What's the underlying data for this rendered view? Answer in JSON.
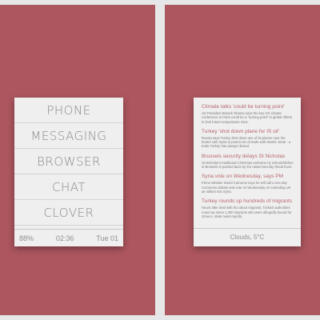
{
  "launcher": {
    "apps": [
      "PHONE",
      "MESSAGING",
      "BROWSER",
      "CHAT",
      "CLOVER"
    ],
    "status": {
      "battery": "88%",
      "time": "02:36",
      "date": "Tue 01"
    }
  },
  "news": {
    "items": [
      {
        "headline": "Climate talks 'could be turning point'",
        "body": "US President Barack Obama says the key UN climate conference in Paris could be a \"turning point\" in global efforts to limit future temperature rises."
      },
      {
        "headline": "Turkey 'shot down plane for IS oil'",
        "body": "Russia says Turkey shot down one of its planes near the border with Syria to protect its oil trade with Islamic State - a trade Turkey has always denied."
      },
      {
        "headline": "Brussels security delays St Nicholas",
        "body": "St Nicholas's traditional Christmas welcome by schoolchildren in Brussels is pushed back by the raised security threat level."
      },
      {
        "headline": "Syria vote on Wednesday, says PM",
        "body": "Prime Minister David Cameron says he will call a one-day Commons debate and vote on Wednesday on extending UK air strikes into Syria."
      },
      {
        "headline": "Turkey rounds up hundreds of migrants",
        "body": "Hours after deal with EU about migrants, Turkish authorities round up some 1,300 migrants who were allegedly bound for Greece, state news reports."
      }
    ],
    "weather": "Clouds, 5°C"
  }
}
